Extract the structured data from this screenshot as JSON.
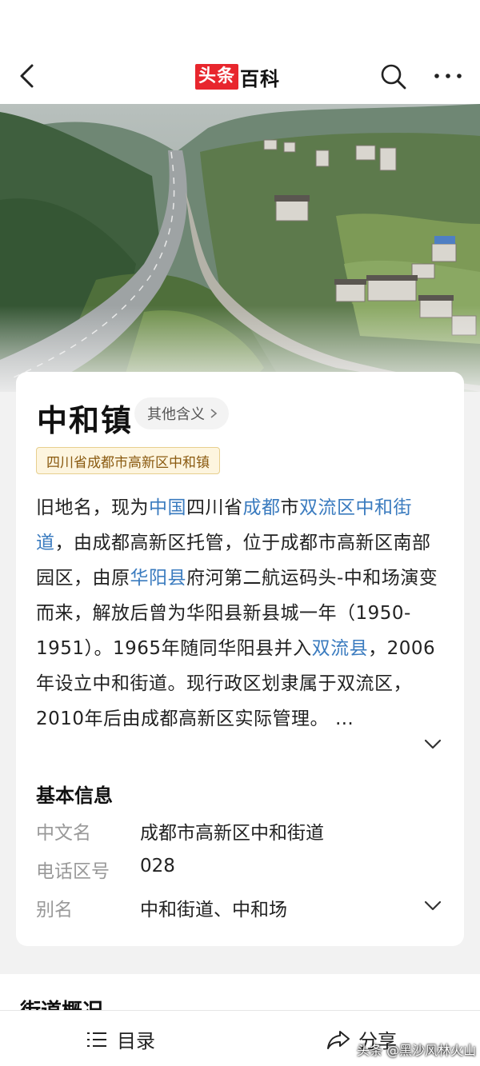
{
  "header": {
    "logo_red": "头条",
    "logo_black": "百科",
    "icons": {
      "back": "chevron-left-icon",
      "search": "search-icon",
      "more": "more-dots-icon"
    }
  },
  "hero": {
    "image": "aerial-highway-village-photo"
  },
  "entry": {
    "title": "中和镇",
    "other_meaning": "其他含义",
    "tag": "四川省成都市高新区中和镇",
    "description": [
      {
        "t": "旧地名，现为"
      },
      {
        "t": "中国",
        "link": true
      },
      {
        "t": "四川省"
      },
      {
        "t": "成都",
        "link": true
      },
      {
        "t": "市"
      },
      {
        "t": "双流区中和街道",
        "link": true
      },
      {
        "t": "，由成都高新区托管，位于成都市高新区南部园区，由原"
      },
      {
        "t": "华阳县",
        "link": true
      },
      {
        "t": "府河第二航运码头-中和场演变而来，解放后曾为华阳县新县城一年（1950-1951）。1965年随同华阳县并入"
      },
      {
        "t": "双流县",
        "link": true
      },
      {
        "t": "，2006年设立中和街道。现行政区划隶属于双流区，2010年后由成都高新区实际管理。 …"
      }
    ]
  },
  "basic_info": {
    "heading": "基本信息",
    "rows": [
      {
        "key": "中文名",
        "value": "成都市高新区中和街道"
      },
      {
        "key": "电话区号",
        "value": "028"
      },
      {
        "key": "别名",
        "value": "中和街道、中和场"
      }
    ]
  },
  "next_section": {
    "title": "街道概况"
  },
  "bottom_bar": {
    "toc_label": "目录",
    "share_label": "分享"
  },
  "watermark": "头条 @黑沙风林火山",
  "colors": {
    "link": "#3a7bbf",
    "brand_red": "#e8262d",
    "tag_bg": "#fdf5df",
    "tag_text": "#8a5a10"
  }
}
